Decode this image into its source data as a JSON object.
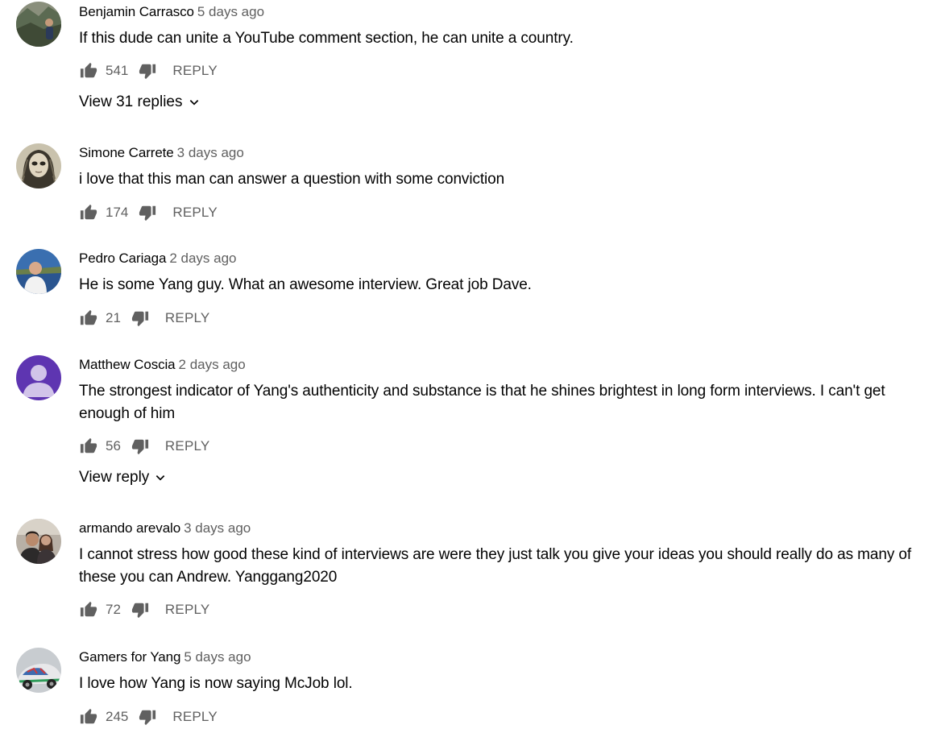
{
  "comments": [
    {
      "author": "Benjamin Carrasco",
      "time": "5 days ago",
      "text": "If this dude can unite a YouTube comment section, he can unite a country.",
      "likes": "541",
      "reply_label": "REPLY",
      "view_replies": "View 31 replies"
    },
    {
      "author": "Simone Carrete",
      "time": "3 days ago",
      "text": "i love that this man can answer a question with some conviction",
      "likes": "174",
      "reply_label": "REPLY"
    },
    {
      "author": "Pedro Cariaga",
      "time": "2 days ago",
      "text": "He is some Yang guy.  What an awesome interview.  Great job Dave.",
      "likes": "21",
      "reply_label": "REPLY"
    },
    {
      "author": "Matthew Coscia",
      "time": "2 days ago",
      "text": "The strongest indicator of Yang's authenticity and substance is that he shines brightest in long form interviews. I can't get enough of him",
      "likes": "56",
      "reply_label": "REPLY",
      "view_replies": "View reply"
    },
    {
      "author": "armando arevalo",
      "time": "3 days ago",
      "text": "I cannot stress how good these kind of interviews are were they just talk you give your ideas you should really do as many of these you can Andrew. Yanggang2020",
      "likes": "72",
      "reply_label": "REPLY"
    },
    {
      "author": "Gamers for Yang",
      "time": "5 days ago",
      "text": "I love how Yang is now saying McJob lol.",
      "likes": "245",
      "reply_label": "REPLY"
    }
  ],
  "icons": {
    "like": "thumb-up-icon",
    "dislike": "thumb-down-icon",
    "expand": "chevron-down-icon"
  },
  "colors": {
    "text": "#030303",
    "secondary": "#606060",
    "default_avatar_bg": "#5e35b1",
    "default_avatar_fg": "#d1c4e9"
  }
}
